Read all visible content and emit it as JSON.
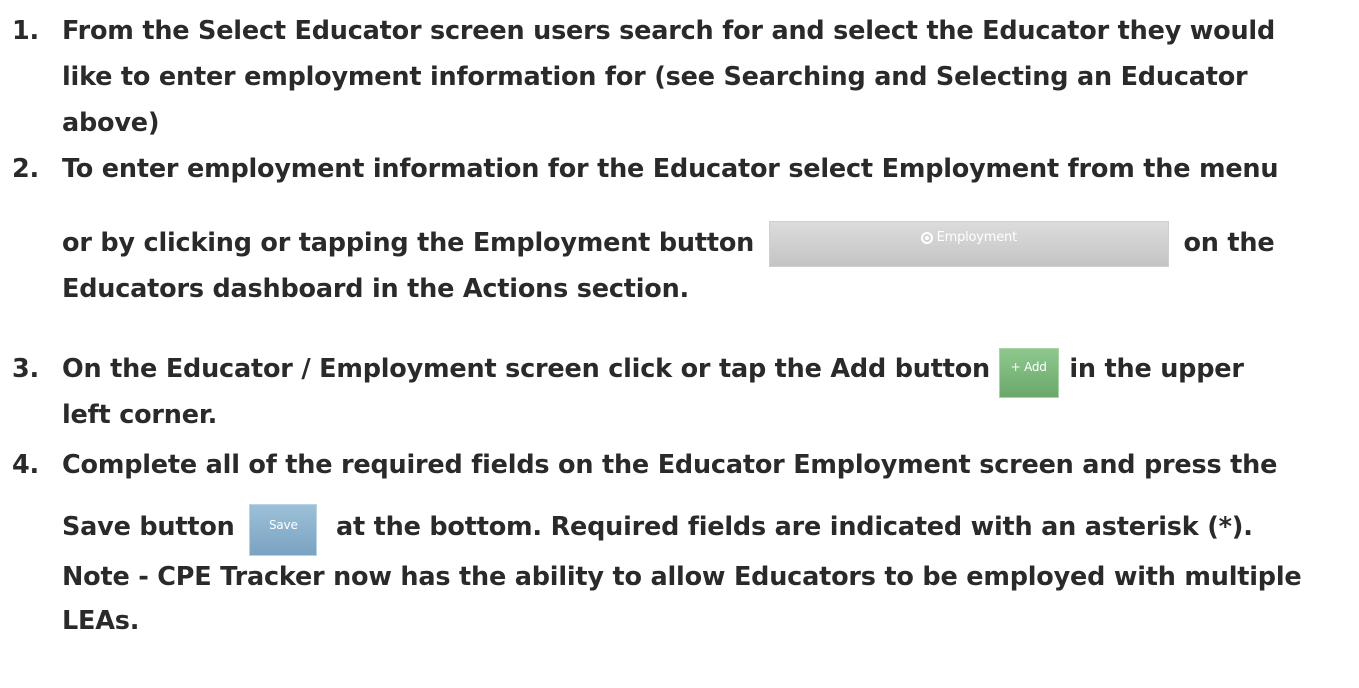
{
  "steps": [
    {
      "number": "1.",
      "lines": [
        "From the Select Educator screen users search for and select the Educator they would",
        "like to enter employment information for (see Searching and Selecting an Educator",
        "above)"
      ]
    },
    {
      "number": "2.",
      "line1": "To enter employment information for the Educator select Employment from the menu",
      "line2_before": "or by clicking or tapping the Employment button",
      "button_label": "Employment",
      "line2_after": "on the",
      "line3": "Educators dashboard in the Actions section."
    },
    {
      "number": "3.",
      "line1_before": "On the Educator / Employment screen click or tap the Add button",
      "button_label": "+ Add",
      "line1_after": "in the upper",
      "line2": "left corner."
    },
    {
      "number": "4.",
      "line1": "Complete all of the required fields on the Educator Employment screen and press the",
      "line2_before": "Save button",
      "button_label": "Save",
      "line2_after": "at the bottom. Required fields are indicated with an asterisk (*).",
      "line3": "Note - CPE Tracker now has the ability to allow Educators to be employed with multiple",
      "line4": "LEAs."
    }
  ],
  "colors": {
    "text": "#2a2a2a",
    "employment_button": "#c4c4c4",
    "add_button": "#6aa86a",
    "save_button": "#7aa3c2"
  }
}
